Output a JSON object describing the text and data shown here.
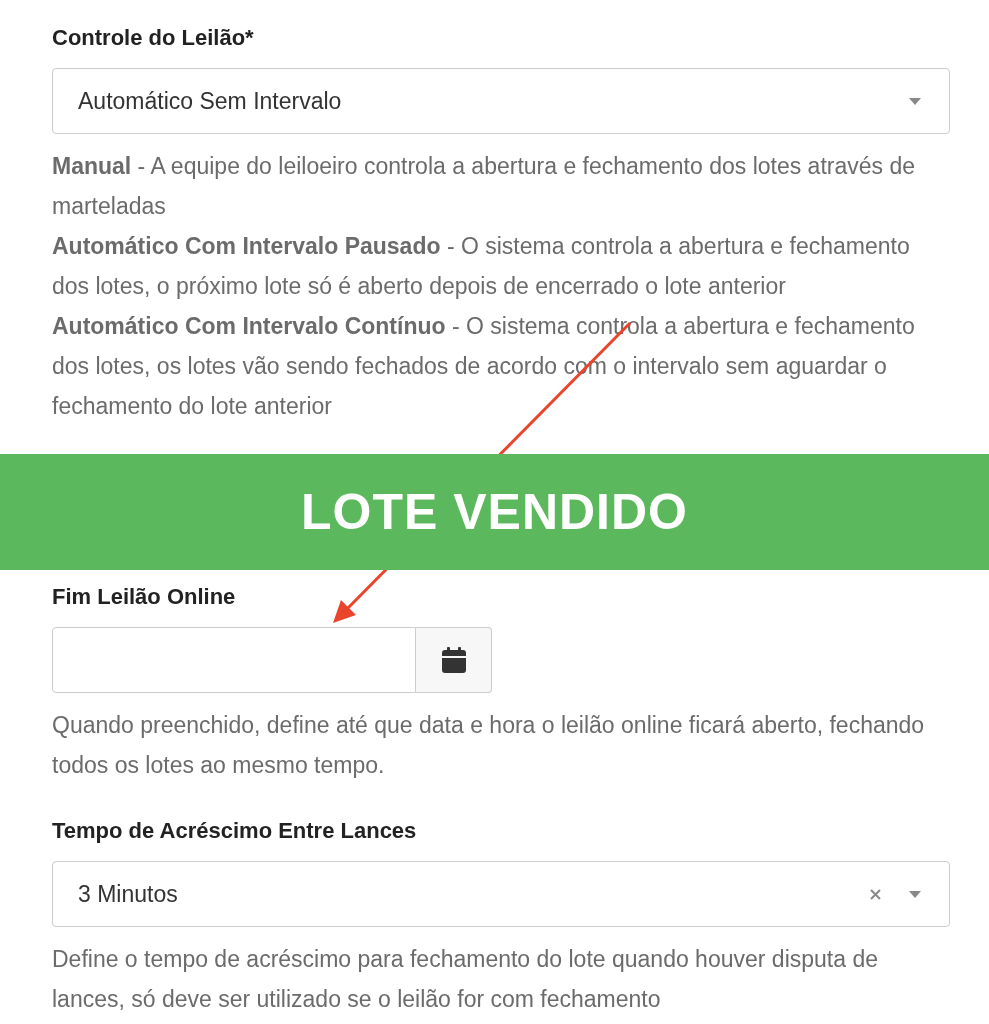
{
  "fields": [
    {
      "kind": "select",
      "label": "Controle do Leilão*",
      "value": "Automático Sem Intervalo",
      "options_help": [
        "**Manual** - A equipe do leiloeiro controla a abertura e fechamento dos lotes através de marteladas",
        "**Automático Com Intervalo Pausado** - O sistema controla a abertura e fechamento dos lotes, o próximo lote só é aberto depois de encerrado o lote anterior",
        "**Automático Com Intervalo Contínuo** - O sistema controla a abertura e fechamento dos lotes, os lotes vão sendo fechados de acordo com o intervalo sem aguardar o fechamento do lote anterior"
      ]
    },
    {
      "kind": "date",
      "label": "Fim Leilão Online",
      "help": "Quando preenchido, define até que data e hora o leilão online ficará aberto, fechando todos os lotes ao mesmo tempo."
    },
    {
      "kind": "select",
      "label": "Tempo de Acréscimo Entre Lances",
      "value": "3 Minutos",
      "clearable": true,
      "help": "Define o tempo de acréscimo para fechamento do lote quando houver disputa de lances, só deve ser utilizado se o leilão for com fechamento"
    }
  ],
  "banner": {
    "text": "LOTE VENDIDO"
  }
}
